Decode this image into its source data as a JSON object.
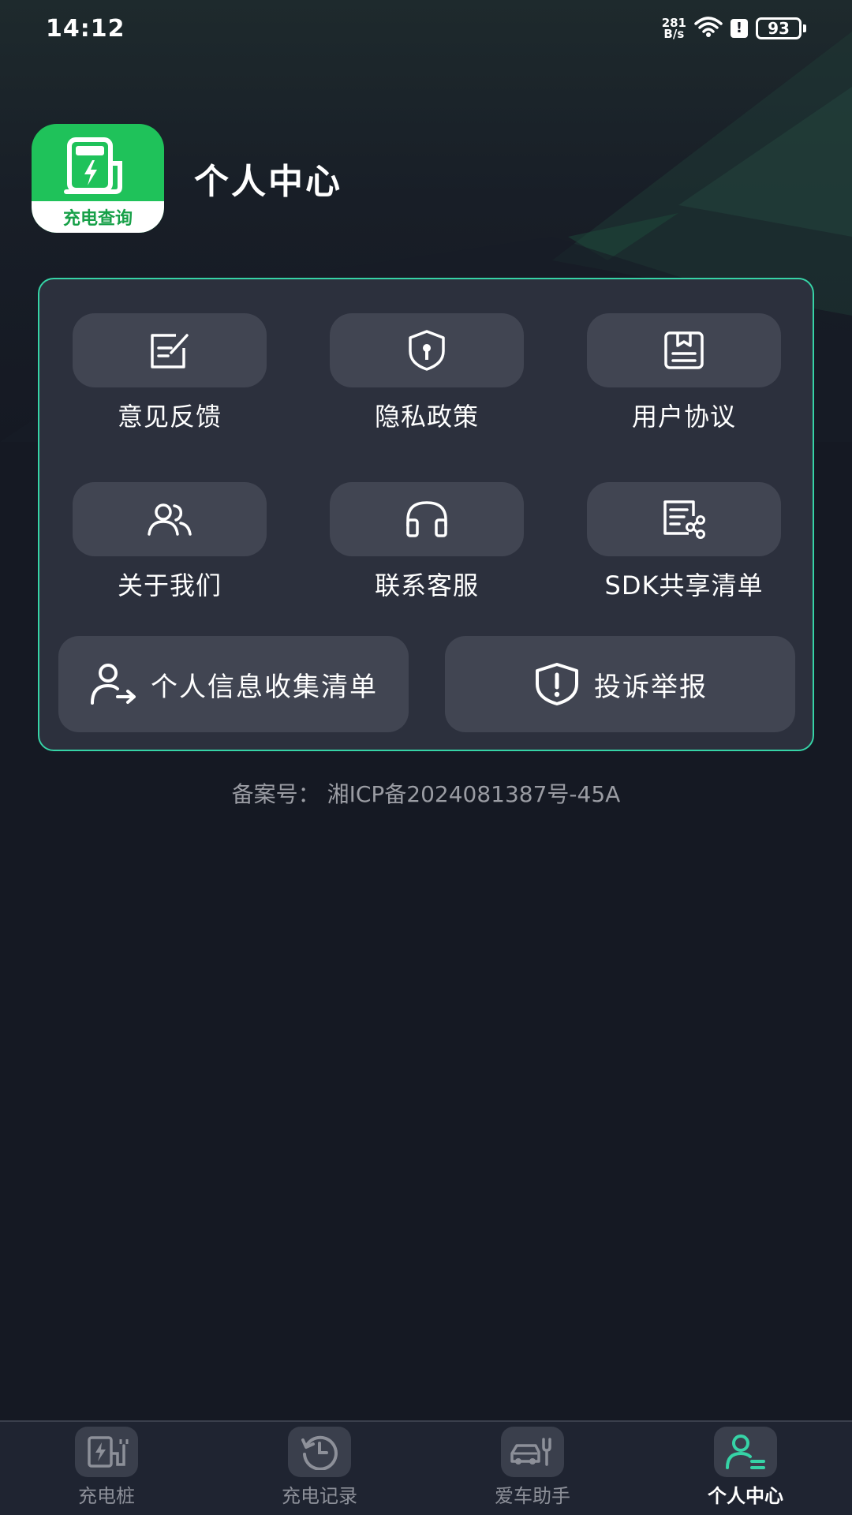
{
  "status_bar": {
    "time": "14:12",
    "net_speed_value": "281",
    "net_speed_unit": "B/s",
    "battery": "93"
  },
  "header": {
    "logo_text": "充电查询",
    "title": "个人中心"
  },
  "menu": {
    "grid": [
      {
        "label": "意见反馈",
        "icon": "feedback-icon"
      },
      {
        "label": "隐私政策",
        "icon": "privacy-shield-icon"
      },
      {
        "label": "用户协议",
        "icon": "agreement-icon"
      },
      {
        "label": "关于我们",
        "icon": "users-icon"
      },
      {
        "label": "联系客服",
        "icon": "headset-icon"
      },
      {
        "label": "SDK共享清单",
        "icon": "share-list-icon"
      }
    ],
    "wide": [
      {
        "label": "个人信息收集清单",
        "icon": "user-export-icon"
      },
      {
        "label": "投诉举报",
        "icon": "alert-shield-icon"
      }
    ]
  },
  "icp": "备案号：  湘ICP备2024081387号-45A",
  "bottom_nav": {
    "items": [
      {
        "label": "充电桩",
        "icon": "charging-pile-icon"
      },
      {
        "label": "充电记录",
        "icon": "history-icon"
      },
      {
        "label": "爱车助手",
        "icon": "car-wrench-icon"
      },
      {
        "label": "个人中心",
        "icon": "profile-icon"
      }
    ],
    "active_index": 3
  },
  "colors": {
    "accent": "#36d3a6",
    "brand_green": "#1fc25a",
    "background": "#151923",
    "card": "#2c303d"
  }
}
